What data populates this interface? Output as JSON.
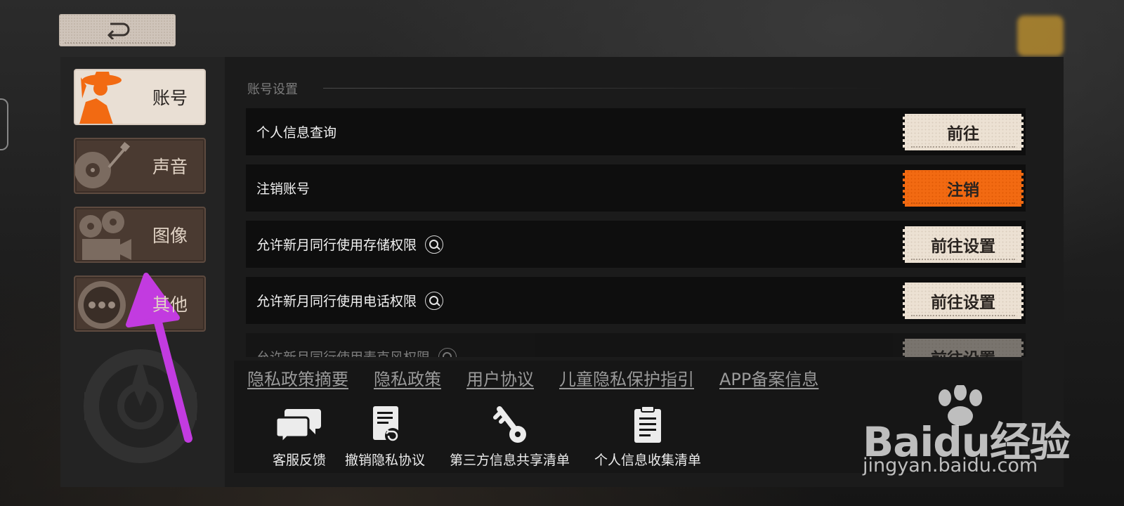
{
  "header": {
    "back_icon": "return-arrow-icon"
  },
  "sidebar": {
    "items": [
      {
        "label": "账号",
        "icon": "cowboy-character-icon",
        "active": true
      },
      {
        "label": "声音",
        "icon": "turntable-icon",
        "active": false
      },
      {
        "label": "图像",
        "icon": "film-camera-icon",
        "active": false
      },
      {
        "label": "其他",
        "icon": "more-dots-icon",
        "active": false
      }
    ]
  },
  "main": {
    "section_title": "账号设置",
    "rows": [
      {
        "label": "个人信息查询",
        "button": "前往",
        "has_info": false,
        "style": "normal"
      },
      {
        "label": "注销账号",
        "button": "注销",
        "has_info": false,
        "style": "danger"
      },
      {
        "label": "允许新月同行使用存储权限",
        "button": "前往设置",
        "has_info": true,
        "style": "normal"
      },
      {
        "label": "允许新月同行使用电话权限",
        "button": "前往设置",
        "has_info": true,
        "style": "normal"
      },
      {
        "label": "允许新月同行使用麦克风权限",
        "button": "前往设置",
        "has_info": true,
        "style": "normal"
      }
    ]
  },
  "footer": {
    "links": [
      "隐私政策摘要",
      "隐私政策",
      "用户协议",
      "儿童隐私保护指引",
      "APP备案信息"
    ],
    "tools": [
      {
        "label": "客服反馈",
        "icon": "chat-bubbles-icon"
      },
      {
        "label": "撤销隐私协议",
        "icon": "document-undo-icon"
      },
      {
        "label": "第三方信息共享清单",
        "icon": "key-icon"
      },
      {
        "label": "个人信息收集清单",
        "icon": "clipboard-icon"
      }
    ]
  },
  "watermark": {
    "brand": "Baidu经验",
    "url": "jingyan.baidu.com"
  },
  "colors": {
    "accent_orange": "#f26a12",
    "tag_beige": "#ece1d3",
    "annotation_arrow": "#c23be0"
  }
}
